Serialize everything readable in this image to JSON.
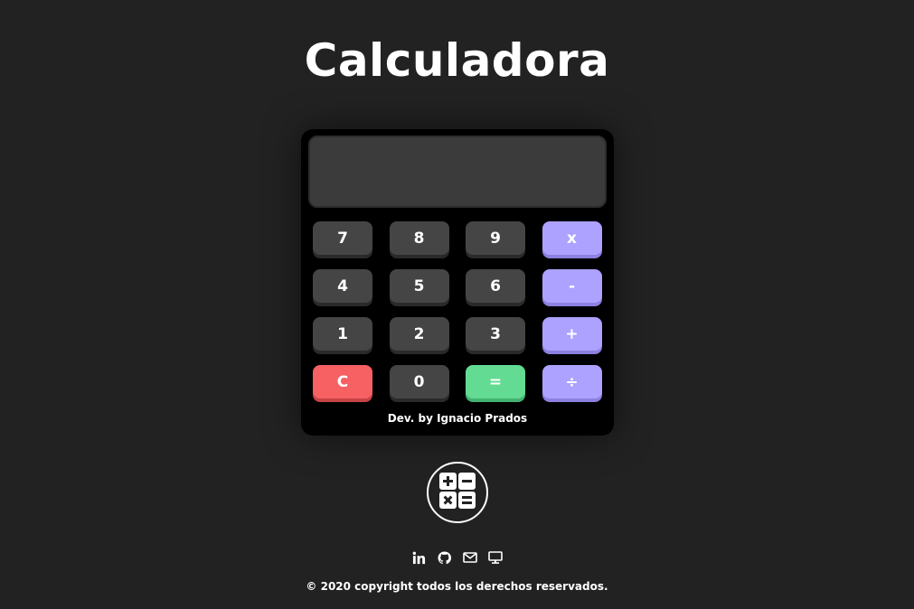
{
  "title": "Calculadora",
  "display": {
    "value": ""
  },
  "keys": {
    "k7": "7",
    "k8": "8",
    "k9": "9",
    "mul": "x",
    "k4": "4",
    "k5": "5",
    "k6": "6",
    "sub": "-",
    "k1": "1",
    "k2": "2",
    "k3": "3",
    "add": "+",
    "clear": "C",
    "k0": "0",
    "equals": "=",
    "div": "÷"
  },
  "credit": "Dev. by Ignacio Prados",
  "logo": {
    "icon": "calculator-icon"
  },
  "social": {
    "linkedin": "linkedin-icon",
    "github": "github-icon",
    "email": "mail-icon",
    "website": "monitor-icon"
  },
  "copyright": "© 2020 copyright todos los derechos reservados.",
  "colors": {
    "background": "#222222",
    "calculator": "#000000",
    "display": "#3b3b3b",
    "key": "#454545",
    "operator": "#ada2ff",
    "clear": "#f76163",
    "equals": "#63db93"
  }
}
